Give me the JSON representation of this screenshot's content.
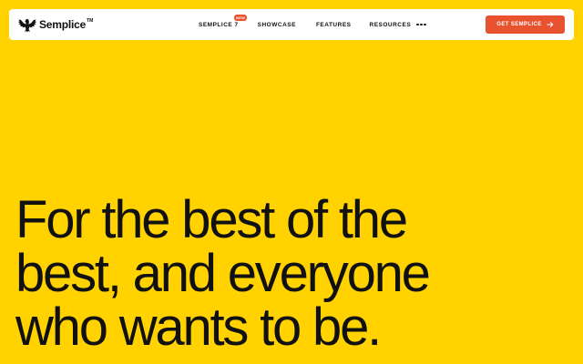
{
  "brand": {
    "name": "Semplice",
    "trademark": "TM",
    "logo_icon": "eagle-icon"
  },
  "nav": {
    "items": [
      {
        "label": "SEMPLICE 7",
        "badge": "NEW"
      },
      {
        "label": "SHOWCASE"
      },
      {
        "label": "FEATURES"
      },
      {
        "label": "RESOURCES"
      }
    ],
    "more_icon": "more-dots-icon"
  },
  "cta": {
    "label": "GET SEMPLICE",
    "icon": "arrow-right-icon"
  },
  "hero": {
    "lines": [
      "For the best of the",
      "best, and everyone",
      "who wants to be."
    ]
  },
  "colors": {
    "background": "#FFD200",
    "accent": "#E8522F",
    "text": "#111111",
    "navbar": "#FFFFFF"
  }
}
